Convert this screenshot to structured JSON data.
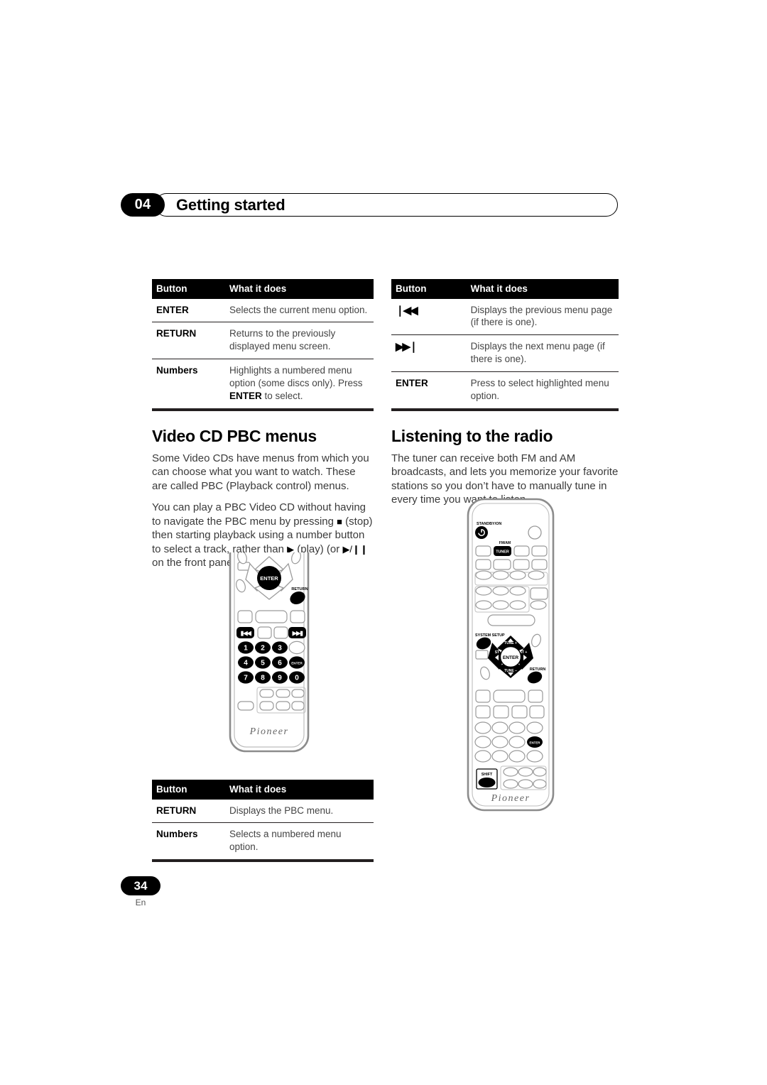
{
  "header": {
    "chapter_number": "04",
    "title": "Getting started"
  },
  "footer": {
    "page_number": "34",
    "language": "En"
  },
  "tables": {
    "dvd_menu": {
      "columns": [
        "Button",
        "What it does"
      ],
      "rows": [
        {
          "button": "ENTER",
          "desc": "Selects the current menu option.",
          "desc_bold": "",
          "desc_tail": ""
        },
        {
          "button": "RETURN",
          "desc": "Returns to the previously displayed menu screen.",
          "desc_bold": "",
          "desc_tail": ""
        },
        {
          "button": "Numbers",
          "desc": "Highlights a numbered menu option (some discs only). Press ",
          "desc_bold": "ENTER",
          "desc_tail": " to select."
        }
      ]
    },
    "page_nav": {
      "columns": [
        "Button",
        "What it does"
      ],
      "rows": [
        {
          "button": "❘◀◀",
          "desc": "Displays the previous menu page (if there is one).",
          "desc_bold": "",
          "desc_tail": ""
        },
        {
          "button": "▶▶❘",
          "desc": "Displays the next menu page (if there is one).",
          "desc_bold": "",
          "desc_tail": ""
        },
        {
          "button": "ENTER",
          "desc": "Press to select highlighted menu option.",
          "desc_bold": "",
          "desc_tail": ""
        }
      ]
    },
    "pbc": {
      "columns": [
        "Button",
        "What it does"
      ],
      "rows": [
        {
          "button": "RETURN",
          "desc": "Displays the PBC menu.",
          "desc_bold": "",
          "desc_tail": ""
        },
        {
          "button": "Numbers",
          "desc": "Selects a numbered menu option.",
          "desc_bold": "",
          "desc_tail": ""
        }
      ]
    }
  },
  "sections": {
    "video_cd": {
      "heading": "Video CD PBC menus",
      "p1": "Some Video CDs have menus from which you can choose what you want to watch. These are called PBC (Playback control) menus.",
      "p2_a": "You can play a PBC Video CD without having to navigate the PBC menu by pressing ",
      "p2_stop": "■",
      "p2_b": " (stop) then starting playback using a number button to select a track, rather than ",
      "p2_play": "▶",
      "p2_c": " (play) (or ",
      "p2_playpause": "▶/❙❙",
      "p2_d": " on the front panel)."
    },
    "radio": {
      "heading": "Listening to the radio",
      "p1": "The tuner can receive both FM and AM broadcasts, and lets you memorize your favorite stations so you don’t have to manually tune in every time you want to listen."
    }
  },
  "remote_left": {
    "brand": "Pioneer",
    "labels": {
      "enter": "ENTER",
      "return": "RETURN",
      "prev": "❘◀◀",
      "next": "▶▶❘",
      "enter_small": "ENTER"
    },
    "numbers": [
      "1",
      "2",
      "3",
      "4",
      "5",
      "6",
      "7",
      "8",
      "9",
      "0"
    ]
  },
  "remote_right": {
    "brand": "Pioneer",
    "labels": {
      "standby": "STANDBY/ON",
      "fm_am": "FM/AM",
      "tuner": "TUNER",
      "system_setup": "SYSTEM SETUP",
      "enter": "ENTER",
      "return": "RETURN",
      "enter_small": "ENTER",
      "shift": "SHIFT",
      "up": "TUNE +",
      "down": "TUNE –",
      "left": "ST –",
      "right": "ST +"
    }
  },
  "colors": {
    "ink": "#231f20",
    "body_text": "#3a3a3a",
    "rule": "#231f20",
    "header_bg": "#000000",
    "paper": "#ffffff"
  }
}
